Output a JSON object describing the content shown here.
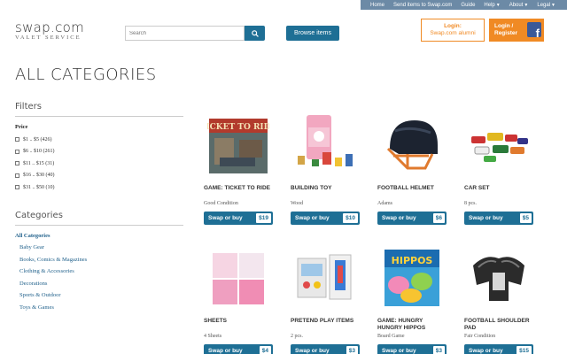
{
  "topnav": {
    "items": [
      "Home",
      "Send items to Swap.com",
      "Guide",
      "Help",
      "About",
      "Legal"
    ]
  },
  "header": {
    "logo_main": "swap.com",
    "logo_sub": "VALET SERVICE",
    "search_placeholder": "Search",
    "browse_label": "Browse items",
    "login_alumni_line1": "Login:",
    "login_alumni_line2": "Swap.com alumni",
    "login_register_line1": "Login /",
    "login_register_line2": "Register",
    "fb_glyph": "f"
  },
  "page_title": "ALL CATEGORIES",
  "sidebar": {
    "filters_heading": "Filters",
    "price_label": "Price",
    "price_ranges": [
      "$1 .. $5 (426)",
      "$6 .. $10 (261)",
      "$11 .. $15 (31)",
      "$16 .. $30 (40)",
      "$31 .. $50 (10)"
    ],
    "categories_heading": "Categories",
    "all_label": "All Categories",
    "categories": [
      "Baby Gear",
      "Books, Comics & Magazines",
      "Clothing & Accessories",
      "Decorations",
      "Sports & Outdoor",
      "Toys & Games"
    ]
  },
  "products": [
    {
      "name": "GAME: TICKET TO RIDE",
      "desc": "Good Condition",
      "buy": "Swap or buy",
      "price": "$19"
    },
    {
      "name": "BUILDING TOY",
      "desc": "Wood",
      "buy": "Swap or buy",
      "price": "$10"
    },
    {
      "name": "FOOTBALL HELMET",
      "desc": "Adams",
      "buy": "Swap or buy",
      "price": "$6"
    },
    {
      "name": "CAR SET",
      "desc": "8 pcs.",
      "buy": "Swap or buy",
      "price": "$5"
    },
    {
      "name": "SHEETS",
      "desc": "4 Sheets",
      "buy": "Swap or buy",
      "price": "$4"
    },
    {
      "name": "PRETEND PLAY ITEMS",
      "desc": "2 pcs.",
      "buy": "Swap or buy",
      "price": "$3"
    },
    {
      "name": "GAME: HUNGRY HUNGRY HIPPOS",
      "desc": "Board Game",
      "buy": "Swap or buy",
      "price": "$3"
    },
    {
      "name": "FOOTBALL SHOULDER PAD",
      "desc": "Fair Condition",
      "buy": "Swap or buy",
      "price": "$15"
    }
  ],
  "box_art": {
    "ticket_to_ride": "TICKET TO RIDE",
    "hippos": "HIPPOS"
  },
  "colors": {
    "primary": "#1e6f95",
    "accent": "#f08a24",
    "nav": "#6c8aa6",
    "facebook": "#3b5998",
    "link": "#1e5f8a"
  }
}
